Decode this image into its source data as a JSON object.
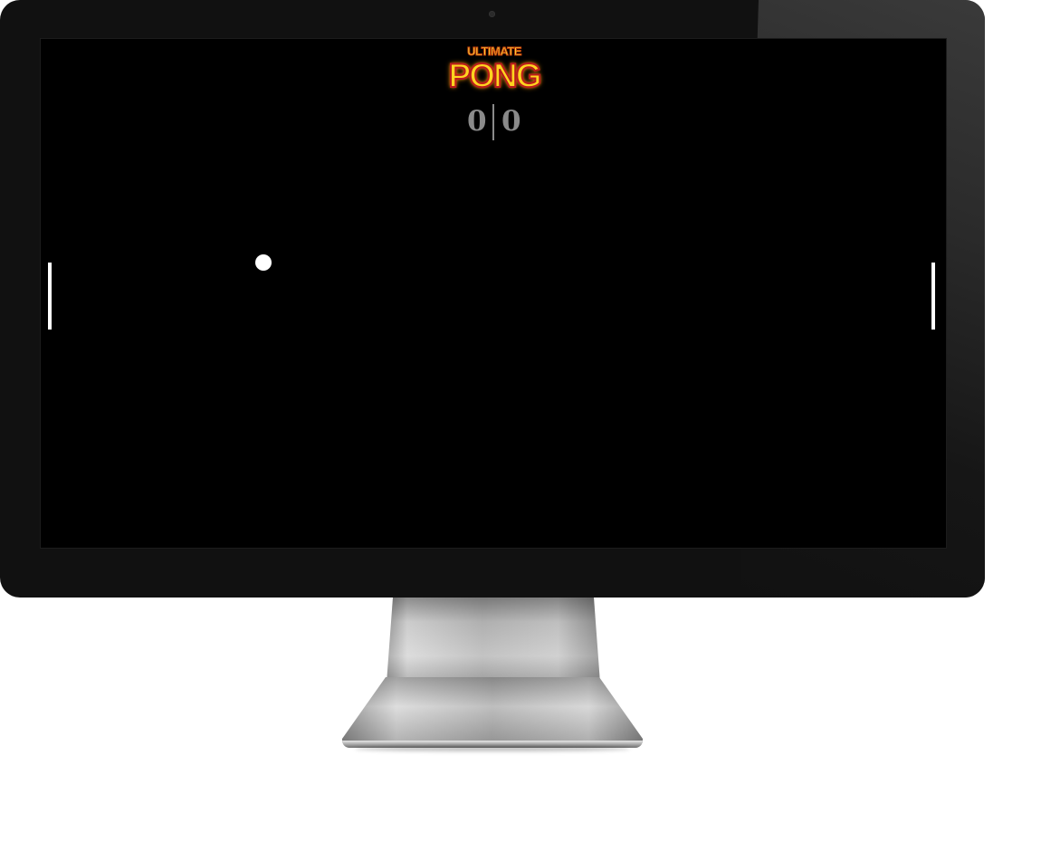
{
  "game": {
    "logo": {
      "top_text": "ULTIMATE",
      "main_text": "PONG"
    },
    "score": {
      "left": "0",
      "right": "0"
    },
    "colors": {
      "screen_background": "#000000",
      "score_text": "#8a8a8a",
      "logo_fill": "#ffd41f",
      "logo_outline": "#b91c1c",
      "paddle": "#ffffff",
      "ball": "#ffffff"
    }
  }
}
